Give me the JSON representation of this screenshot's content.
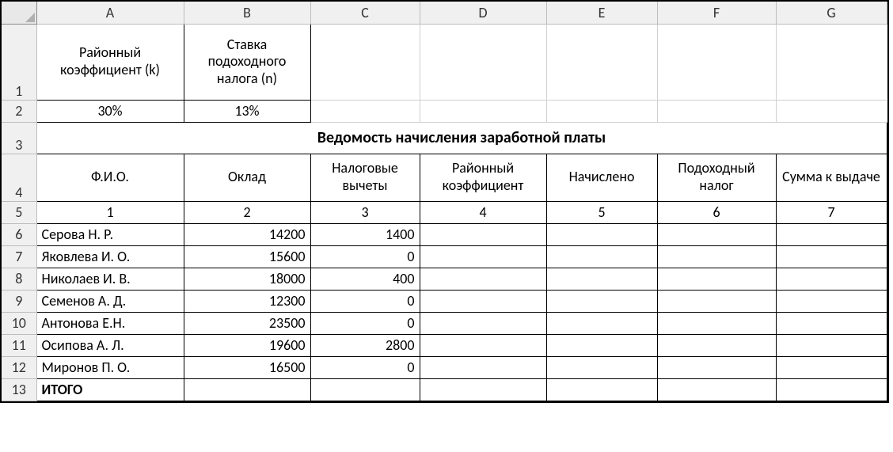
{
  "columns": [
    "A",
    "B",
    "C",
    "D",
    "E",
    "F",
    "G"
  ],
  "row_numbers": [
    "1",
    "2",
    "3",
    "4",
    "5",
    "6",
    "7",
    "8",
    "9",
    "10",
    "11",
    "12",
    "13"
  ],
  "params": {
    "coeff_label": "Районный коэффициент (k)",
    "tax_label": "Ставка подоходного налога (n)",
    "coeff_value": "30%",
    "tax_value": "13%"
  },
  "title": "Ведомость начисления заработной платы",
  "headers": {
    "fio": "Ф.И.О.",
    "oklad": "Оклад",
    "vychety": "Налоговые вычеты",
    "rk": "Районный коэффициент",
    "nachisleno": "Начислено",
    "podnalog": "Подоходный налог",
    "summa": "Сумма к выдаче"
  },
  "colnums": {
    "c1": "1",
    "c2": "2",
    "c3": "3",
    "c4": "4",
    "c5": "5",
    "c6": "6",
    "c7": "7"
  },
  "rows": [
    {
      "fio": "Серова Н. Р.",
      "oklad": "14200",
      "vych": "1400"
    },
    {
      "fio": "Яковлева И. О.",
      "oklad": "15600",
      "vych": "0"
    },
    {
      "fio": "Николаев И. В.",
      "oklad": "18000",
      "vych": "400"
    },
    {
      "fio": "Семенов А. Д.",
      "oklad": "12300",
      "vych": "0"
    },
    {
      "fio": "Антонова Е.Н.",
      "oklad": "23500",
      "vych": "0"
    },
    {
      "fio": "Осипова А. Л.",
      "oklad": "19600",
      "vych": "2800"
    },
    {
      "fio": "Миронов П. О.",
      "oklad": "16500",
      "vych": "0"
    }
  ],
  "total_label": "ИТОГО",
  "chart_data": {
    "type": "table",
    "title": "Ведомость начисления заработной платы",
    "parameters": {
      "district_coefficient_k": 0.3,
      "income_tax_rate_n": 0.13
    },
    "columns": [
      "Ф.И.О.",
      "Оклад",
      "Налоговые вычеты",
      "Районный коэффициент",
      "Начислено",
      "Подоходный налог",
      "Сумма к выдаче"
    ],
    "column_numbers": [
      1,
      2,
      3,
      4,
      5,
      6,
      7
    ],
    "data": [
      {
        "fio": "Серова Н. Р.",
        "oklad": 14200,
        "nalog_vychety": 1400,
        "rayon_koeff": null,
        "nachisleno": null,
        "podohod_nalog": null,
        "summa_k_vydache": null
      },
      {
        "fio": "Яковлева И. О.",
        "oklad": 15600,
        "nalog_vychety": 0,
        "rayon_koeff": null,
        "nachisleno": null,
        "podohod_nalog": null,
        "summa_k_vydache": null
      },
      {
        "fio": "Николаев И. В.",
        "oklad": 18000,
        "nalog_vychety": 400,
        "rayon_koeff": null,
        "nachisleno": null,
        "podohod_nalog": null,
        "summa_k_vydache": null
      },
      {
        "fio": "Семенов А. Д.",
        "oklad": 12300,
        "nalog_vychety": 0,
        "rayon_koeff": null,
        "nachisleno": null,
        "podohod_nalog": null,
        "summa_k_vydache": null
      },
      {
        "fio": "Антонова Е.Н.",
        "oklad": 23500,
        "nalog_vychety": 0,
        "rayon_koeff": null,
        "nachisleno": null,
        "podohod_nalog": null,
        "summa_k_vydache": null
      },
      {
        "fio": "Осипова А. Л.",
        "oklad": 19600,
        "nalog_vychety": 2800,
        "rayon_koeff": null,
        "nachisleno": null,
        "podohod_nalog": null,
        "summa_k_vydache": null
      },
      {
        "fio": "Миронов П. О.",
        "oklad": 16500,
        "nalog_vychety": 0,
        "rayon_koeff": null,
        "nachisleno": null,
        "podohod_nalog": null,
        "summa_k_vydache": null
      }
    ],
    "totals_row_label": "ИТОГО"
  }
}
